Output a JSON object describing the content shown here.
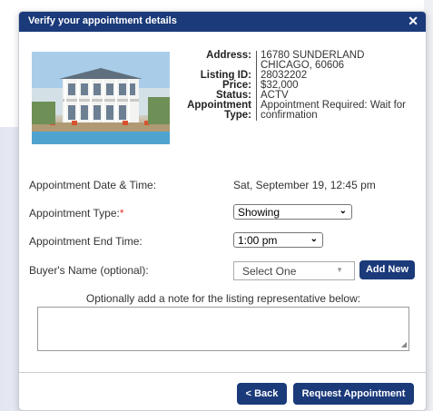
{
  "dialog": {
    "title": "Verify your appointment details",
    "close_icon": "close-icon"
  },
  "listing": {
    "photo": "house-photo",
    "labels": {
      "address": "Address:",
      "listing_id": "Listing ID:",
      "price": "Price:",
      "status": "Status:",
      "appointment_type_1": "Appointment",
      "appointment_type_2": "Type:"
    },
    "address_line1": "16780 SUNDERLAND",
    "address_line2": "CHICAGO, 60606",
    "listing_id": "28032202",
    "price": "$32,000",
    "status": "ACTV",
    "appointment_type_line1": "Appointment Required: Wait for",
    "appointment_type_line2": "confirmation"
  },
  "form": {
    "datetime_label": "Appointment Date & Time:",
    "datetime_value": "Sat, September 19, 12:45 pm",
    "type_label": "Appointment Type:",
    "required_marker": "*",
    "type_value": "Showing",
    "end_label": "Appointment End Time:",
    "end_value": "1:00 pm",
    "buyer_label": "Buyer's Name (optional):",
    "buyer_value": "Select One",
    "add_new_label": "Add New",
    "note_label": "Optionally add a note for the listing representative below:",
    "note_value": ""
  },
  "footer": {
    "back_label": "< Back",
    "request_label": "Request Appointment"
  },
  "colors": {
    "title_bar": "#1b3a7a",
    "button": "#1b3a7a",
    "required": "#e33333"
  }
}
